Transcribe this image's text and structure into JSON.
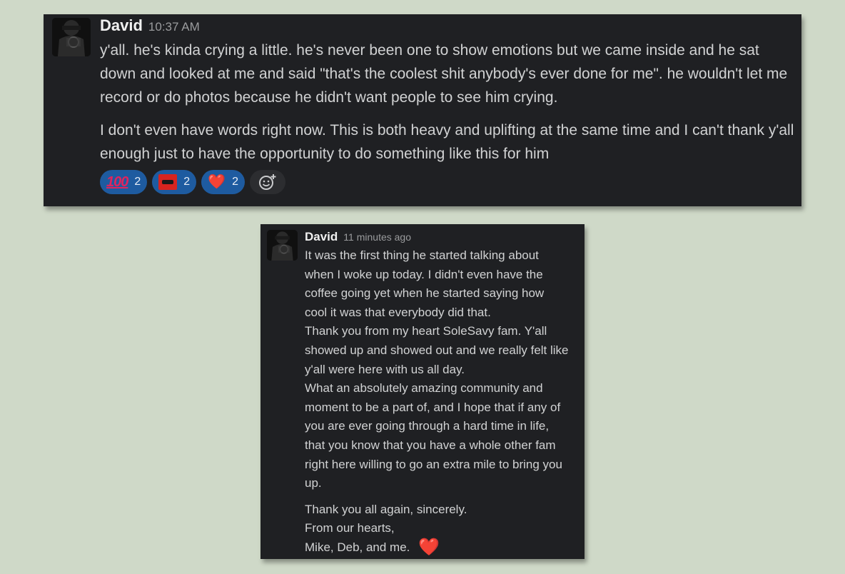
{
  "post1": {
    "author": "David",
    "timestamp": "10:37 AM",
    "paragraphs": [
      "y'all.  he's kinda crying a little.  he's never been one to show emotions but we came inside and he sat down and looked at me and said \"that's the coolest shit anybody's ever done for me\".  he wouldn't let me record or do photos because he didn't want people to see him crying.",
      "I don't even have words right now.  This is both heavy and uplifting at the same time and I can't thank y'all enough just to have the opportunity to do something like this for him"
    ],
    "reactions": [
      {
        "emoji": "100",
        "count": "2"
      },
      {
        "emoji": "custom-logo",
        "count": "2"
      },
      {
        "emoji": "❤️",
        "count": "2"
      }
    ],
    "add_reaction_icon": "add-emoji-icon"
  },
  "post2": {
    "author": "David",
    "timestamp": "11 minutes ago",
    "lines": [
      "It was the first thing he started talking about",
      "when I woke up today.  I didn't even have the",
      "coffee going yet when he started saying how",
      "cool it was that everybody did that.",
      "Thank you from my heart SoleSavy fam.  Y'all",
      "showed up and showed out and we really felt like",
      "y'all were here with us all day.",
      "What an absolutely amazing community and",
      "moment to be a part of, and I hope that if any of",
      "you are ever going through a hard time in life,",
      "that you know that you have a whole other fam",
      "right here willing to go an extra mile to bring you",
      "up."
    ],
    "closing": [
      "Thank you all again, sincerely.",
      "From our hearts,",
      "Mike, Deb, and me."
    ],
    "closing_emoji": "❤️"
  },
  "colors": {
    "background": "#cfd9c8",
    "card": "#1f2023",
    "reaction_pill": "#1e5ba0"
  }
}
